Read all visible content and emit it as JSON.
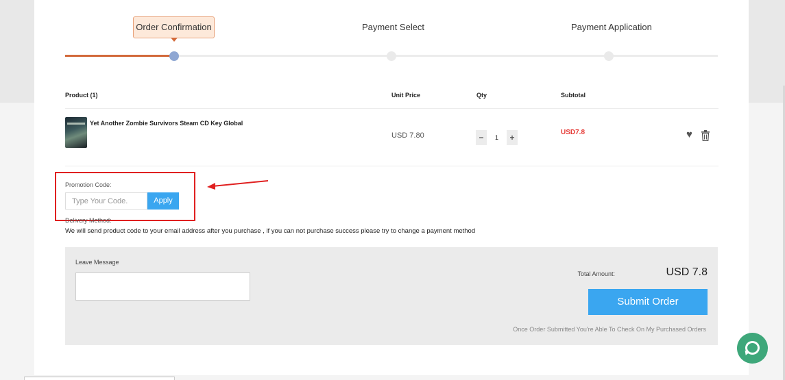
{
  "steps": [
    {
      "label": "Order Confirmation"
    },
    {
      "label": "Payment Select"
    },
    {
      "label": "Payment Application"
    }
  ],
  "table": {
    "headers": {
      "product": "Product (1)",
      "unit_price": "Unit Price",
      "qty": "Qty",
      "subtotal": "Subtotal"
    },
    "rows": [
      {
        "name": "Yet Another Zombie Survivors Steam CD Key Global",
        "unit_price": "USD 7.80",
        "qty": "1",
        "subtotal": "USD7.8"
      }
    ]
  },
  "promo": {
    "label": "Promotion Code:",
    "placeholder": "Type Your Code.",
    "apply": "Apply"
  },
  "delivery": {
    "label": "Delivery Method:",
    "text": "We will send product code to your email address after you purchase , if you can not purchase success please try to change a payment method"
  },
  "order": {
    "leave_message": "Leave Message",
    "total_label": "Total Amount:",
    "total_value": "USD 7.8",
    "submit": "Submit Order",
    "note": "Once Order Submitted You're Able To Check On My Purchased Orders"
  },
  "colors": {
    "accent": "#3aa6f0",
    "progress": "#d2693b",
    "price_red": "#e53935",
    "annotation": "#e02020",
    "chat": "#3ea77a"
  },
  "icons": [
    "heart-icon",
    "trash-icon",
    "minus-icon",
    "plus-icon",
    "chat-icon"
  ]
}
